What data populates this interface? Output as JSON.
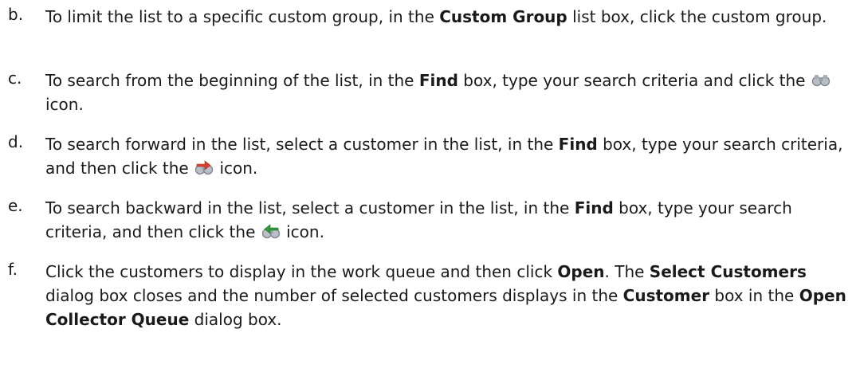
{
  "items": [
    {
      "letter": "b.",
      "parts": [
        "To limit the list to a specific custom group, in the ",
        "Custom Group",
        " list box, click the custom group."
      ]
    },
    {
      "letter": "c.",
      "parts": [
        "To search from the beginning of the list, in the ",
        "Find",
        " box, type your search criteria and click the ",
        "icon."
      ],
      "icon": "binoculars-icon"
    },
    {
      "letter": "d.",
      "parts": [
        "To search forward in the list, select a customer in the list, in the ",
        "Find",
        " box, type your search criteria, and then click the ",
        "icon."
      ],
      "icon": "binoculars-forward-red-icon"
    },
    {
      "letter": "e.",
      "parts": [
        "To search backward in the list, select a customer in the list, in the ",
        "Find",
        " box, type your search criteria, and then click the ",
        "icon."
      ],
      "icon": "binoculars-backward-green-icon"
    },
    {
      "letter": "f.",
      "parts": [
        "Click the customers to display in the work queue and then click ",
        "Open",
        ". The ",
        "Select Customers",
        " dialog box closes and the number of selected customers displays in the ",
        "Customer",
        " box in the ",
        "Open Collector Queue",
        " dialog box."
      ]
    }
  ],
  "colors": {
    "text": "#1a1a1a",
    "icon_red": "#d9412b",
    "icon_green": "#2f9a3a",
    "icon_gray": "#8a8f99"
  }
}
